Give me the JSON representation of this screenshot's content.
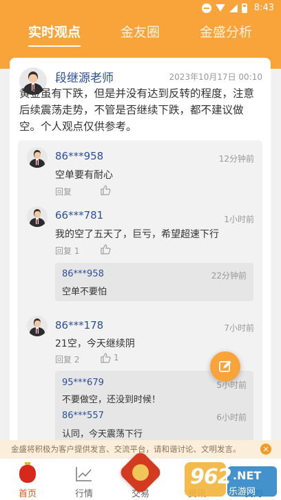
{
  "status_bar": {
    "time": "8:43"
  },
  "tabs": [
    {
      "label": "实时观点",
      "active": true
    },
    {
      "label": "金友圈",
      "active": false
    },
    {
      "label": "金盛分析",
      "active": false
    }
  ],
  "post": {
    "author": "段继源老师",
    "time": "2023年10月17日 00:10",
    "content": "黄金虽有下跌，但是并没有达到反转的程度，注意后续震荡走势，不管是否继续下跌，都不建议做空。个人观点仅供参考。"
  },
  "comments": [
    {
      "user": "86***958",
      "time": "12分钟前",
      "text": "空单要有耐心",
      "reply_label": "回复",
      "like_count": ""
    },
    {
      "user": "66***781",
      "time": "1小时前",
      "text": "我的空了五天了，巨亏，希望超速下行",
      "reply_label": "回复 1",
      "like_count": "",
      "replies": [
        {
          "user": "86***958",
          "time": "22分钟前",
          "text": "空单不要怕"
        }
      ]
    },
    {
      "user": "86***178",
      "time": "7小时前",
      "text": "21空，今天继续阴",
      "reply_label": "回复 2",
      "like_count": "1",
      "replies": [
        {
          "user": "95***679",
          "time": "5小时前",
          "text": "不要做空，还没到时候！"
        },
        {
          "user": "86***557",
          "time": "6小时前",
          "text": "认同，今天震荡下行"
        }
      ]
    }
  ],
  "notice": {
    "text": "金盛将积极为客户提供发言、交流平台，请和谐讨论、文明发言。",
    "close_label": "×"
  },
  "bottom_nav": [
    {
      "label": "首页",
      "icon": "lantern-icon",
      "active": true
    },
    {
      "label": "行情",
      "icon": "chart-line-icon",
      "active": false
    },
    {
      "label": "交易",
      "icon": "trade-logo-icon",
      "active": false
    },
    {
      "label": "资讯",
      "icon": "news-icon",
      "active": false
    },
    {
      "label": "我的",
      "icon": "user-icon",
      "active": false
    }
  ],
  "watermark": {
    "text": "962",
    "suffix": ".NET",
    "site": "乐游网"
  },
  "colors": {
    "brand_orange": "#f9a43b",
    "link_blue": "#2b4e9b",
    "active_red": "#e0541b"
  }
}
